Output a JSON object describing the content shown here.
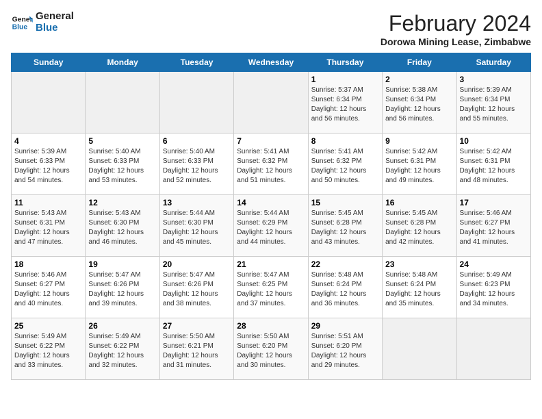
{
  "header": {
    "logo_line1": "General",
    "logo_line2": "Blue",
    "title": "February 2024",
    "subtitle": "Dorowa Mining Lease, Zimbabwe"
  },
  "days_of_week": [
    "Sunday",
    "Monday",
    "Tuesday",
    "Wednesday",
    "Thursday",
    "Friday",
    "Saturday"
  ],
  "weeks": [
    [
      {
        "num": "",
        "info": ""
      },
      {
        "num": "",
        "info": ""
      },
      {
        "num": "",
        "info": ""
      },
      {
        "num": "",
        "info": ""
      },
      {
        "num": "1",
        "info": "Sunrise: 5:37 AM\nSunset: 6:34 PM\nDaylight: 12 hours\nand 56 minutes."
      },
      {
        "num": "2",
        "info": "Sunrise: 5:38 AM\nSunset: 6:34 PM\nDaylight: 12 hours\nand 56 minutes."
      },
      {
        "num": "3",
        "info": "Sunrise: 5:39 AM\nSunset: 6:34 PM\nDaylight: 12 hours\nand 55 minutes."
      }
    ],
    [
      {
        "num": "4",
        "info": "Sunrise: 5:39 AM\nSunset: 6:33 PM\nDaylight: 12 hours\nand 54 minutes."
      },
      {
        "num": "5",
        "info": "Sunrise: 5:40 AM\nSunset: 6:33 PM\nDaylight: 12 hours\nand 53 minutes."
      },
      {
        "num": "6",
        "info": "Sunrise: 5:40 AM\nSunset: 6:33 PM\nDaylight: 12 hours\nand 52 minutes."
      },
      {
        "num": "7",
        "info": "Sunrise: 5:41 AM\nSunset: 6:32 PM\nDaylight: 12 hours\nand 51 minutes."
      },
      {
        "num": "8",
        "info": "Sunrise: 5:41 AM\nSunset: 6:32 PM\nDaylight: 12 hours\nand 50 minutes."
      },
      {
        "num": "9",
        "info": "Sunrise: 5:42 AM\nSunset: 6:31 PM\nDaylight: 12 hours\nand 49 minutes."
      },
      {
        "num": "10",
        "info": "Sunrise: 5:42 AM\nSunset: 6:31 PM\nDaylight: 12 hours\nand 48 minutes."
      }
    ],
    [
      {
        "num": "11",
        "info": "Sunrise: 5:43 AM\nSunset: 6:31 PM\nDaylight: 12 hours\nand 47 minutes."
      },
      {
        "num": "12",
        "info": "Sunrise: 5:43 AM\nSunset: 6:30 PM\nDaylight: 12 hours\nand 46 minutes."
      },
      {
        "num": "13",
        "info": "Sunrise: 5:44 AM\nSunset: 6:30 PM\nDaylight: 12 hours\nand 45 minutes."
      },
      {
        "num": "14",
        "info": "Sunrise: 5:44 AM\nSunset: 6:29 PM\nDaylight: 12 hours\nand 44 minutes."
      },
      {
        "num": "15",
        "info": "Sunrise: 5:45 AM\nSunset: 6:28 PM\nDaylight: 12 hours\nand 43 minutes."
      },
      {
        "num": "16",
        "info": "Sunrise: 5:45 AM\nSunset: 6:28 PM\nDaylight: 12 hours\nand 42 minutes."
      },
      {
        "num": "17",
        "info": "Sunrise: 5:46 AM\nSunset: 6:27 PM\nDaylight: 12 hours\nand 41 minutes."
      }
    ],
    [
      {
        "num": "18",
        "info": "Sunrise: 5:46 AM\nSunset: 6:27 PM\nDaylight: 12 hours\nand 40 minutes."
      },
      {
        "num": "19",
        "info": "Sunrise: 5:47 AM\nSunset: 6:26 PM\nDaylight: 12 hours\nand 39 minutes."
      },
      {
        "num": "20",
        "info": "Sunrise: 5:47 AM\nSunset: 6:26 PM\nDaylight: 12 hours\nand 38 minutes."
      },
      {
        "num": "21",
        "info": "Sunrise: 5:47 AM\nSunset: 6:25 PM\nDaylight: 12 hours\nand 37 minutes."
      },
      {
        "num": "22",
        "info": "Sunrise: 5:48 AM\nSunset: 6:24 PM\nDaylight: 12 hours\nand 36 minutes."
      },
      {
        "num": "23",
        "info": "Sunrise: 5:48 AM\nSunset: 6:24 PM\nDaylight: 12 hours\nand 35 minutes."
      },
      {
        "num": "24",
        "info": "Sunrise: 5:49 AM\nSunset: 6:23 PM\nDaylight: 12 hours\nand 34 minutes."
      }
    ],
    [
      {
        "num": "25",
        "info": "Sunrise: 5:49 AM\nSunset: 6:22 PM\nDaylight: 12 hours\nand 33 minutes."
      },
      {
        "num": "26",
        "info": "Sunrise: 5:49 AM\nSunset: 6:22 PM\nDaylight: 12 hours\nand 32 minutes."
      },
      {
        "num": "27",
        "info": "Sunrise: 5:50 AM\nSunset: 6:21 PM\nDaylight: 12 hours\nand 31 minutes."
      },
      {
        "num": "28",
        "info": "Sunrise: 5:50 AM\nSunset: 6:20 PM\nDaylight: 12 hours\nand 30 minutes."
      },
      {
        "num": "29",
        "info": "Sunrise: 5:51 AM\nSunset: 6:20 PM\nDaylight: 12 hours\nand 29 minutes."
      },
      {
        "num": "",
        "info": ""
      },
      {
        "num": "",
        "info": ""
      }
    ]
  ]
}
